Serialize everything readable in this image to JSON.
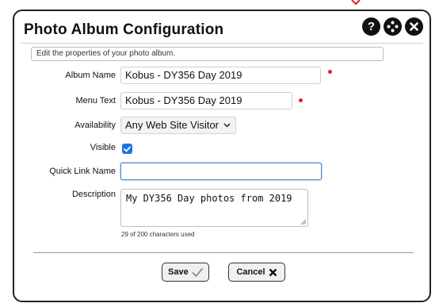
{
  "dialog": {
    "title": "Photo Album Configuration",
    "title_icons": [
      "help-icon",
      "move-icon",
      "close-icon"
    ],
    "hint": "Edit the properties of your photo album."
  },
  "form": {
    "album_name": {
      "label": "Album Name",
      "value": "Kobus - DY356 Day 2019",
      "required": true
    },
    "menu_text": {
      "label": "Menu Text",
      "value": "Kobus - DY356 Day 2019",
      "required": true
    },
    "availability": {
      "label": "Availability",
      "selected": "Any Web Site Visitor"
    },
    "visible": {
      "label": "Visible",
      "checked": true
    },
    "quick_link_name": {
      "label": "Quick Link Name",
      "value": ""
    },
    "description": {
      "label": "Description",
      "value": "My DY356 Day photos from 2019",
      "counter": "29 of 200 characters used"
    }
  },
  "buttons": {
    "save_label": "Save",
    "cancel_label": "Cancel"
  },
  "colors": {
    "required_dot": "#e0202a",
    "checkbox": "#1a73e8",
    "focus_border": "#4a90d9"
  }
}
